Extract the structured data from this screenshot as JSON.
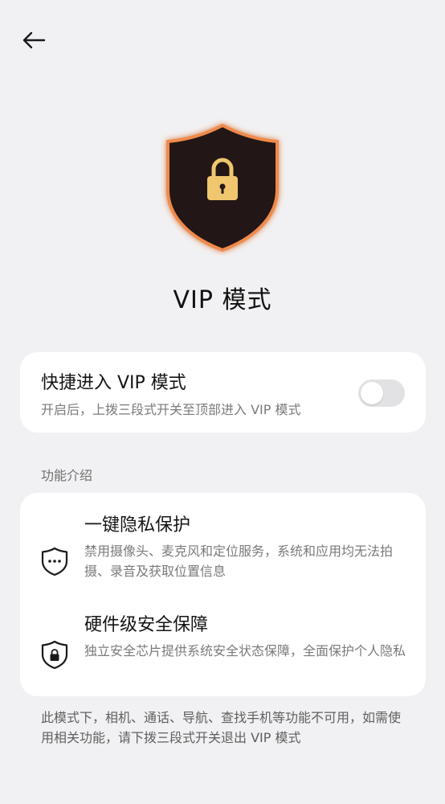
{
  "header": {
    "back_icon": "arrow-left-icon"
  },
  "hero": {
    "icon": "shield-lock-icon",
    "title": "VIP 模式",
    "colors": {
      "shield_fill": "#241816",
      "glow": "#f08a4b",
      "lock": "#f0c66e"
    }
  },
  "quick_entry": {
    "title": "快捷进入 VIP 模式",
    "subtitle": "开启后，上拨三段式开关至顶部进入 VIP 模式",
    "toggle_on": false
  },
  "features_section": {
    "label": "功能介绍",
    "items": [
      {
        "icon": "shield-password-icon",
        "title": "一键隐私保护",
        "description": "禁用摄像头、麦克风和定位服务，系统和应用均无法拍摄、录音及获取位置信息"
      },
      {
        "icon": "shield-lock-small-icon",
        "title": "硬件级安全保障",
        "description": "独立安全芯片提供系统安全状态保障，全面保护个人隐私"
      }
    ]
  },
  "footer": {
    "note": "此模式下，相机、通话、导航、查找手机等功能不可用，如需使用相关功能，请下拨三段式开关退出 VIP 模式"
  }
}
